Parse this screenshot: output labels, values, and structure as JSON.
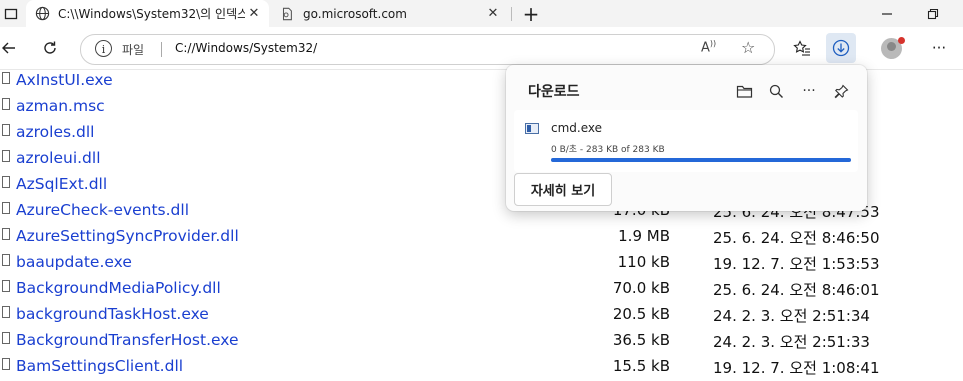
{
  "browser": {
    "tabs": [
      {
        "title": "C:\\\\Windows\\System32\\의 인덱스",
        "active": true,
        "icon": "globe-icon"
      },
      {
        "title": "go.microsoft.com",
        "active": false,
        "icon": "page-icon"
      }
    ],
    "new_tab_label": "+",
    "address": {
      "chip": "파일",
      "url": "C://Windows/System32/"
    },
    "read_aloud_label": "A",
    "accent_color": "#2468d8"
  },
  "files": [
    {
      "name": "AxInstUI.exe",
      "size": "",
      "date": ""
    },
    {
      "name": "azman.msc",
      "size": "",
      "date": ""
    },
    {
      "name": "azroles.dll",
      "size": "",
      "date": ""
    },
    {
      "name": "azroleui.dll",
      "size": "",
      "date": ""
    },
    {
      "name": "AzSqlExt.dll",
      "size": "",
      "date": ""
    },
    {
      "name": "AzureCheck-events.dll",
      "size": "17.0 kB",
      "date": "25. 6. 24. 오전 8:47:53"
    },
    {
      "name": "AzureSettingSyncProvider.dll",
      "size": "1.9 MB",
      "date": "25. 6. 24. 오전 8:46:50"
    },
    {
      "name": "baaupdate.exe",
      "size": "110 kB",
      "date": "19. 12. 7. 오전 1:53:53"
    },
    {
      "name": "BackgroundMediaPolicy.dll",
      "size": "70.0 kB",
      "date": "25. 6. 24. 오전 8:46:01"
    },
    {
      "name": "backgroundTaskHost.exe",
      "size": "20.5 kB",
      "date": "24. 2. 3. 오전 2:51:34"
    },
    {
      "name": "BackgroundTransferHost.exe",
      "size": "36.5 kB",
      "date": "24. 2. 3. 오전 2:51:33"
    },
    {
      "name": "BamSettingsClient.dll",
      "size": "15.5 kB",
      "date": "19. 12. 7. 오전 1:08:41"
    }
  ],
  "downloads": {
    "title": "다운로드",
    "item": {
      "file_name": "cmd.exe",
      "status": "0 B/초 - 283 KB of 283 KB",
      "progress_percent": 100
    },
    "show_more_label": "자세히 보기"
  }
}
